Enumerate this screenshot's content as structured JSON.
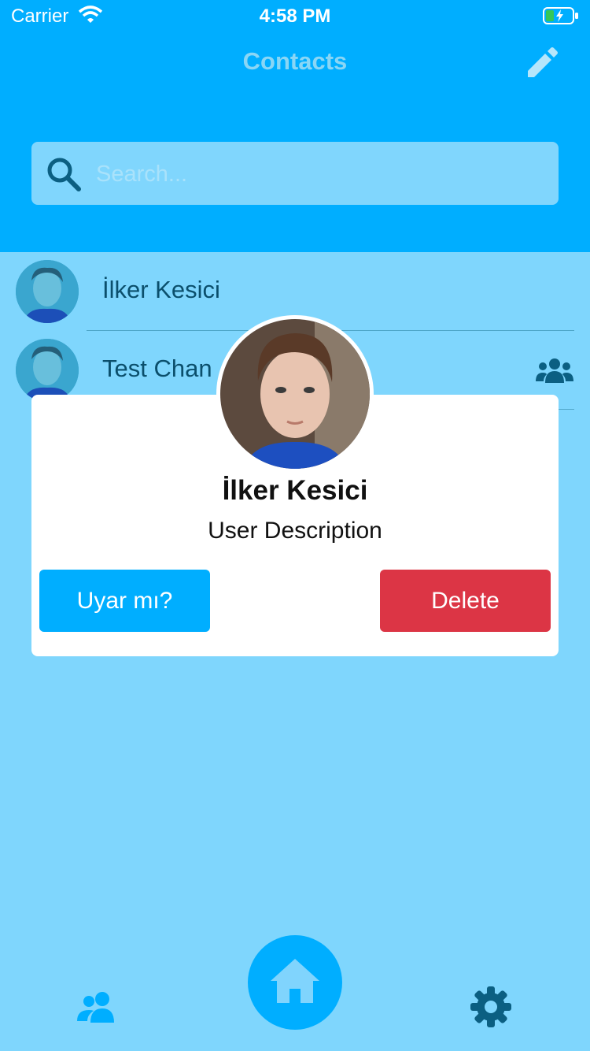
{
  "status_bar": {
    "carrier": "Carrier",
    "time": "4:58 PM"
  },
  "header": {
    "title": "Contacts",
    "edit_icon": "pencil-icon"
  },
  "search": {
    "placeholder": "Search...",
    "icon": "search-icon"
  },
  "contacts": [
    {
      "name": "İlker Kesici",
      "group": false
    },
    {
      "name": "Test Chan",
      "group": true
    }
  ],
  "modal": {
    "name": "İlker Kesici",
    "description": "User Description",
    "warn_label": "Uyar mı?",
    "delete_label": "Delete"
  },
  "tabbar": {
    "left_icon": "people-icon",
    "center_icon": "home-icon",
    "right_icon": "gear-icon"
  },
  "colors": {
    "primary": "#00aeff",
    "background": "#7fd6fd",
    "danger": "#dc3545",
    "text": "#0b4f6c"
  }
}
